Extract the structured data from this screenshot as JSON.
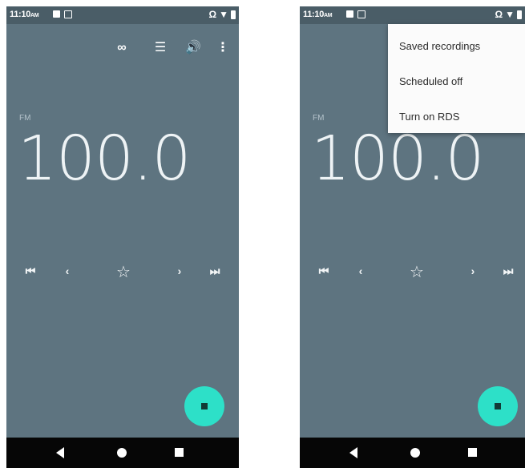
{
  "status_bar": {
    "time": "11:10",
    "ampm": "AM"
  },
  "toolbar": {
    "record_icon": "∞",
    "list_icon": "☰",
    "speaker_icon": "🔊",
    "overflow_icon": "⋮"
  },
  "station": {
    "band": "FM",
    "frequency": "100.0"
  },
  "controls": {
    "skip_prev": "⏮",
    "prev": "‹",
    "favorite": "☆",
    "next": "›",
    "skip_next": "⏭"
  },
  "menu": {
    "items": [
      "Saved recordings",
      "Scheduled off",
      "Turn on RDS"
    ]
  },
  "colors": {
    "background": "#5e7480",
    "status_bar": "#4a5d67",
    "fab": "#2de0c8",
    "menu_bg": "#fbfbfb",
    "nav_bar": "#060606"
  }
}
